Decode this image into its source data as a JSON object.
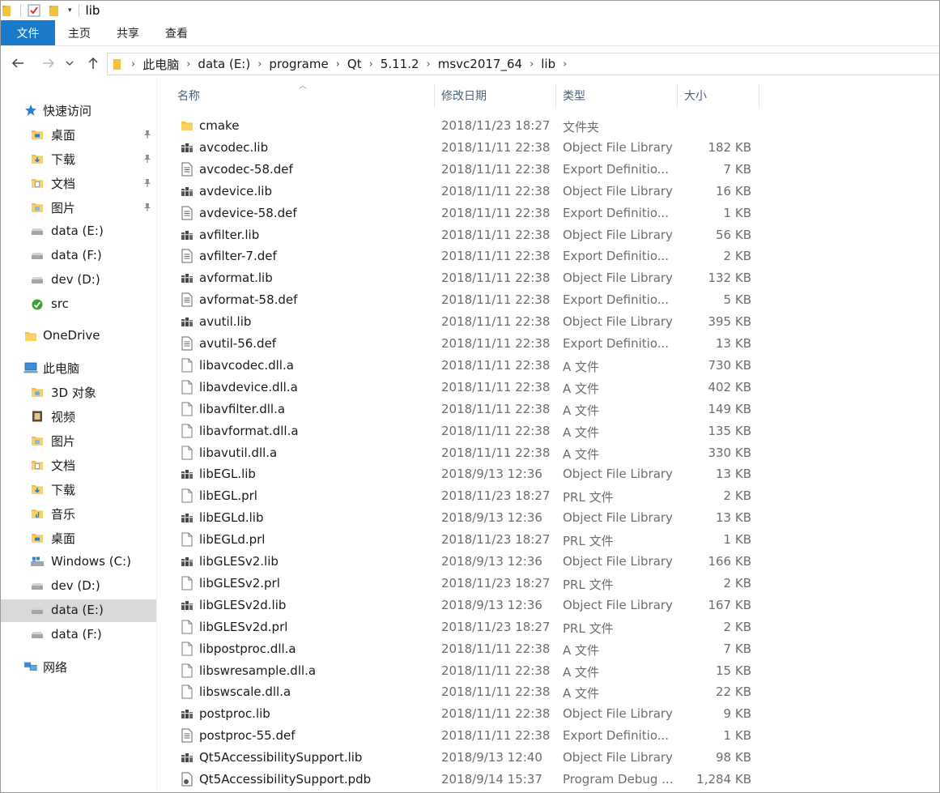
{
  "window": {
    "title": "lib"
  },
  "ribbon": {
    "tabs": [
      "文件",
      "主页",
      "共享",
      "查看"
    ]
  },
  "address": {
    "crumbs": [
      "此电脑",
      "data (E:)",
      "programe",
      "Qt",
      "5.11.2",
      "msvc2017_64",
      "lib"
    ]
  },
  "sidebar": {
    "items": [
      {
        "label": "快速访问",
        "icon": "star-icon",
        "level": 0,
        "pinned": false
      },
      {
        "label": "桌面",
        "icon": "desktop-folder-icon",
        "level": 1,
        "pinned": true
      },
      {
        "label": "下载",
        "icon": "downloads-folder-icon",
        "level": 1,
        "pinned": true
      },
      {
        "label": "文档",
        "icon": "documents-folder-icon",
        "level": 1,
        "pinned": true
      },
      {
        "label": "图片",
        "icon": "pictures-folder-icon",
        "level": 1,
        "pinned": true
      },
      {
        "label": "data (E:)",
        "icon": "drive-icon",
        "level": 1,
        "pinned": false
      },
      {
        "label": "data (F:)",
        "icon": "drive-icon",
        "level": 1,
        "pinned": false
      },
      {
        "label": "dev (D:)",
        "icon": "drive-icon",
        "level": 1,
        "pinned": false
      },
      {
        "label": "src",
        "icon": "green-folder-icon",
        "level": 1,
        "pinned": false
      },
      {
        "label": "OneDrive",
        "icon": "folder-icon",
        "level": 0,
        "pinned": false
      },
      {
        "label": "此电脑",
        "icon": "computer-icon",
        "level": 0,
        "pinned": false
      },
      {
        "label": "3D 对象",
        "icon": "3d-objects-folder-icon",
        "level": 1,
        "pinned": false
      },
      {
        "label": "视频",
        "icon": "videos-folder-icon",
        "level": 1,
        "pinned": false
      },
      {
        "label": "图片",
        "icon": "pictures-folder-icon",
        "level": 1,
        "pinned": false
      },
      {
        "label": "文档",
        "icon": "documents-folder-icon",
        "level": 1,
        "pinned": false
      },
      {
        "label": "下载",
        "icon": "downloads-folder-icon",
        "level": 1,
        "pinned": false
      },
      {
        "label": "音乐",
        "icon": "music-folder-icon",
        "level": 1,
        "pinned": false
      },
      {
        "label": "桌面",
        "icon": "desktop-folder-icon",
        "level": 1,
        "pinned": false
      },
      {
        "label": "Windows (C:)",
        "icon": "windows-drive-icon",
        "level": 1,
        "pinned": false
      },
      {
        "label": "dev (D:)",
        "icon": "drive-icon",
        "level": 1,
        "pinned": false
      },
      {
        "label": "data (E:)",
        "icon": "drive-icon",
        "level": 1,
        "pinned": false,
        "selected": true
      },
      {
        "label": "data (F:)",
        "icon": "drive-icon",
        "level": 1,
        "pinned": false
      },
      {
        "label": "网络",
        "icon": "network-icon",
        "level": 0,
        "pinned": false
      }
    ]
  },
  "columns": {
    "name": "名称",
    "date": "修改日期",
    "type": "类型",
    "size": "大小"
  },
  "files": [
    {
      "name": "cmake",
      "date": "2018/11/23 18:27",
      "type": "文件夹",
      "size": "",
      "icon": "folder-icon"
    },
    {
      "name": "avcodec.lib",
      "date": "2018/11/11 22:38",
      "type": "Object File Library",
      "size": "182 KB",
      "icon": "library-file-icon"
    },
    {
      "name": "avcodec-58.def",
      "date": "2018/11/11 22:38",
      "type": "Export Definitio...",
      "size": "7 KB",
      "icon": "text-file-icon"
    },
    {
      "name": "avdevice.lib",
      "date": "2018/11/11 22:38",
      "type": "Object File Library",
      "size": "16 KB",
      "icon": "library-file-icon"
    },
    {
      "name": "avdevice-58.def",
      "date": "2018/11/11 22:38",
      "type": "Export Definitio...",
      "size": "1 KB",
      "icon": "text-file-icon"
    },
    {
      "name": "avfilter.lib",
      "date": "2018/11/11 22:38",
      "type": "Object File Library",
      "size": "56 KB",
      "icon": "library-file-icon"
    },
    {
      "name": "avfilter-7.def",
      "date": "2018/11/11 22:38",
      "type": "Export Definitio...",
      "size": "2 KB",
      "icon": "text-file-icon"
    },
    {
      "name": "avformat.lib",
      "date": "2018/11/11 22:38",
      "type": "Object File Library",
      "size": "132 KB",
      "icon": "library-file-icon"
    },
    {
      "name": "avformat-58.def",
      "date": "2018/11/11 22:38",
      "type": "Export Definitio...",
      "size": "5 KB",
      "icon": "text-file-icon"
    },
    {
      "name": "avutil.lib",
      "date": "2018/11/11 22:38",
      "type": "Object File Library",
      "size": "395 KB",
      "icon": "library-file-icon"
    },
    {
      "name": "avutil-56.def",
      "date": "2018/11/11 22:38",
      "type": "Export Definitio...",
      "size": "13 KB",
      "icon": "text-file-icon"
    },
    {
      "name": "libavcodec.dll.a",
      "date": "2018/11/11 22:38",
      "type": "A 文件",
      "size": "730 KB",
      "icon": "blank-file-icon"
    },
    {
      "name": "libavdevice.dll.a",
      "date": "2018/11/11 22:38",
      "type": "A 文件",
      "size": "402 KB",
      "icon": "blank-file-icon"
    },
    {
      "name": "libavfilter.dll.a",
      "date": "2018/11/11 22:38",
      "type": "A 文件",
      "size": "149 KB",
      "icon": "blank-file-icon"
    },
    {
      "name": "libavformat.dll.a",
      "date": "2018/11/11 22:38",
      "type": "A 文件",
      "size": "135 KB",
      "icon": "blank-file-icon"
    },
    {
      "name": "libavutil.dll.a",
      "date": "2018/11/11 22:38",
      "type": "A 文件",
      "size": "330 KB",
      "icon": "blank-file-icon"
    },
    {
      "name": "libEGL.lib",
      "date": "2018/9/13 12:36",
      "type": "Object File Library",
      "size": "13 KB",
      "icon": "library-file-icon"
    },
    {
      "name": "libEGL.prl",
      "date": "2018/11/23 18:27",
      "type": "PRL 文件",
      "size": "2 KB",
      "icon": "blank-file-icon"
    },
    {
      "name": "libEGLd.lib",
      "date": "2018/9/13 12:36",
      "type": "Object File Library",
      "size": "13 KB",
      "icon": "library-file-icon"
    },
    {
      "name": "libEGLd.prl",
      "date": "2018/11/23 18:27",
      "type": "PRL 文件",
      "size": "1 KB",
      "icon": "blank-file-icon"
    },
    {
      "name": "libGLESv2.lib",
      "date": "2018/9/13 12:36",
      "type": "Object File Library",
      "size": "166 KB",
      "icon": "library-file-icon"
    },
    {
      "name": "libGLESv2.prl",
      "date": "2018/11/23 18:27",
      "type": "PRL 文件",
      "size": "2 KB",
      "icon": "blank-file-icon"
    },
    {
      "name": "libGLESv2d.lib",
      "date": "2018/9/13 12:36",
      "type": "Object File Library",
      "size": "167 KB",
      "icon": "library-file-icon"
    },
    {
      "name": "libGLESv2d.prl",
      "date": "2018/11/23 18:27",
      "type": "PRL 文件",
      "size": "2 KB",
      "icon": "blank-file-icon"
    },
    {
      "name": "libpostproc.dll.a",
      "date": "2018/11/11 22:38",
      "type": "A 文件",
      "size": "7 KB",
      "icon": "blank-file-icon"
    },
    {
      "name": "libswresample.dll.a",
      "date": "2018/11/11 22:38",
      "type": "A 文件",
      "size": "15 KB",
      "icon": "blank-file-icon"
    },
    {
      "name": "libswscale.dll.a",
      "date": "2018/11/11 22:38",
      "type": "A 文件",
      "size": "22 KB",
      "icon": "blank-file-icon"
    },
    {
      "name": "postproc.lib",
      "date": "2018/11/11 22:38",
      "type": "Object File Library",
      "size": "9 KB",
      "icon": "library-file-icon"
    },
    {
      "name": "postproc-55.def",
      "date": "2018/11/11 22:38",
      "type": "Export Definitio...",
      "size": "1 KB",
      "icon": "text-file-icon"
    },
    {
      "name": "Qt5AccessibilitySupport.lib",
      "date": "2018/9/13 12:40",
      "type": "Object File Library",
      "size": "98 KB",
      "icon": "library-file-icon"
    },
    {
      "name": "Qt5AccessibilitySupport.pdb",
      "date": "2018/9/14 15:37",
      "type": "Program Debug ...",
      "size": "1,284 KB",
      "icon": "debug-file-icon"
    }
  ],
  "colors": {
    "file_tab": "#1979ca",
    "selection": "#d9d9d9",
    "folder": "#f3c13a",
    "header_text": "#4c607a"
  }
}
